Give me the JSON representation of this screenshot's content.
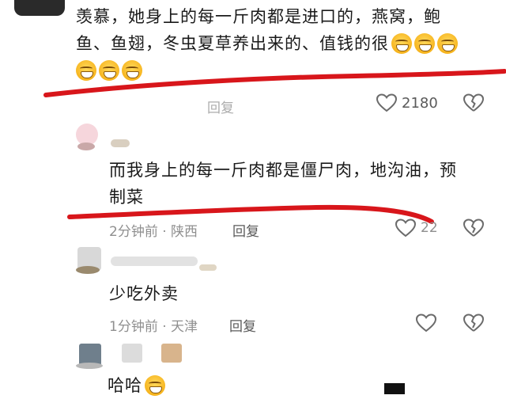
{
  "comments": [
    {
      "text_line1": "羡慕，她身上的每一斤肉都是进口的，燕窝，鲍",
      "text_line2": "鱼、鱼翅，冬虫夏草养出来的、值钱的很",
      "emoji_name": "grinning-sweat-emoji",
      "reply_label": "回复",
      "like_count": "2180"
    },
    {
      "text_line1": "而我身上的每一斤肉都是僵尸肉，地沟油，预",
      "text_line2": "制菜",
      "time": "2分钟前",
      "location": "陕西",
      "reply_label": "回复",
      "like_count": "22"
    },
    {
      "text": "少吃外卖",
      "time": "1分钟前",
      "location": "天津",
      "reply_label": "回复"
    },
    {
      "text": "哈哈"
    }
  ],
  "separator": "·",
  "colors": {
    "underline": "#d8161b",
    "meta": "#8f8f8f",
    "icon": "#6b6b6b"
  }
}
